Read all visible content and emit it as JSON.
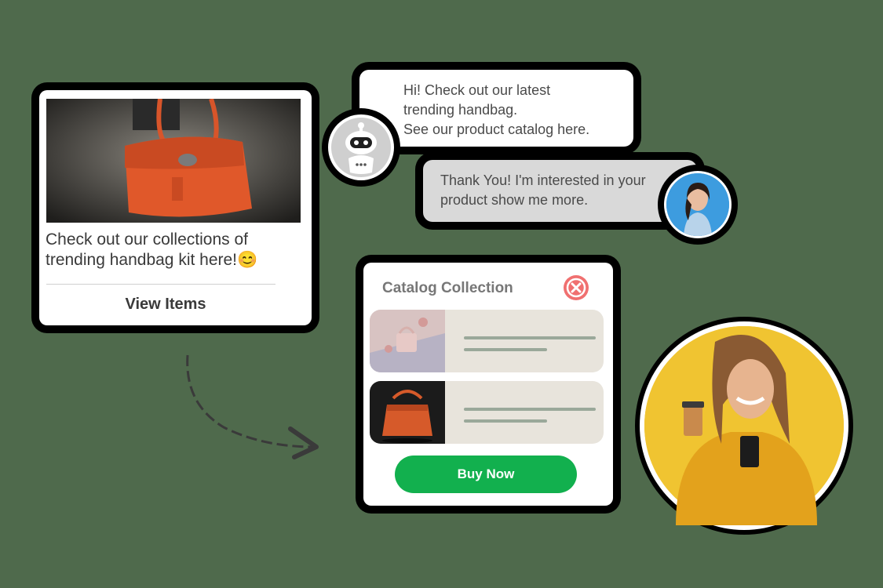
{
  "product_card": {
    "text": "Check out our collections of trending handbag kit here!😊",
    "button_label": "View Items"
  },
  "chat": {
    "bot_message_line1": "Hi! Check out our latest",
    "bot_message_line2": "trending handbag.",
    "bot_message_line3": "See our product catalog here.",
    "user_message": "Thank You! I'm interested in your product show me more."
  },
  "catalog": {
    "title": "Catalog Collection",
    "buy_label": "Buy Now"
  },
  "colors": {
    "background": "#4f6a4c",
    "buy_button": "#12b04e",
    "close_button": "#f07070",
    "bag_orange": "#e0582a",
    "circle_yellow": "#f0c431"
  },
  "icons": {
    "bot": "robot-icon",
    "close": "close-icon"
  }
}
